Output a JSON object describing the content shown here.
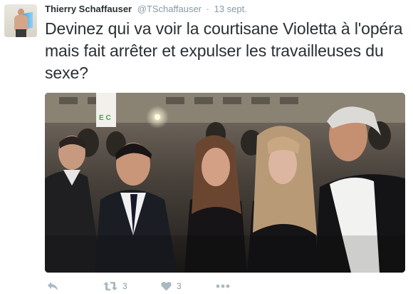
{
  "tweet": {
    "author_name": "Thierry Schaffauser",
    "author_handle": "@TSchaffauser",
    "separator": "·",
    "timestamp": "13 sept.",
    "text": "Devinez qui va voir la courtisane Violetta à l'opéra mais fait arrêter et expulser les travailleuses du sexe?",
    "photo_sign_text": "E C"
  },
  "actions": {
    "reply_icon": "reply-icon",
    "retweet_icon": "retweet-icon",
    "retweet_count": "3",
    "like_icon": "heart-icon",
    "like_count": "3",
    "more_icon": "more-dots-icon"
  },
  "colors": {
    "text": "#292f33",
    "muted": "#8899a6",
    "icon": "#aab8c2"
  }
}
